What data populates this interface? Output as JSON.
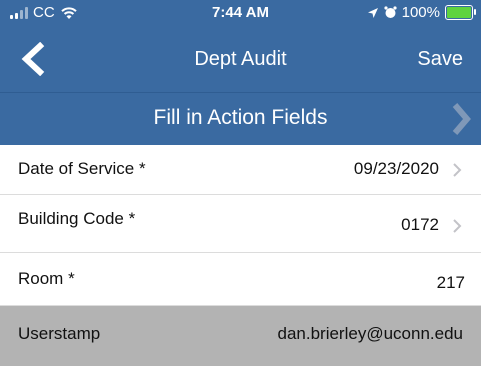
{
  "status_bar": {
    "carrier": "CC",
    "time": "7:44 AM",
    "battery": "100%"
  },
  "nav": {
    "title": "Dept Audit",
    "save_label": "Save"
  },
  "action_bar": {
    "label": "Fill in Action Fields"
  },
  "fields": [
    {
      "label": "Date of Service *",
      "value": "09/23/2020"
    },
    {
      "label": "Building Code *",
      "value": "0172"
    },
    {
      "label": "Room *",
      "value": "217"
    },
    {
      "label": "Userstamp",
      "value": "dan.brierley@uconn.edu"
    }
  ],
  "colors": {
    "header_blue": "#3a6aa1",
    "readonly_grey": "#b3b3b3",
    "battery_green": "#5fd33f"
  }
}
